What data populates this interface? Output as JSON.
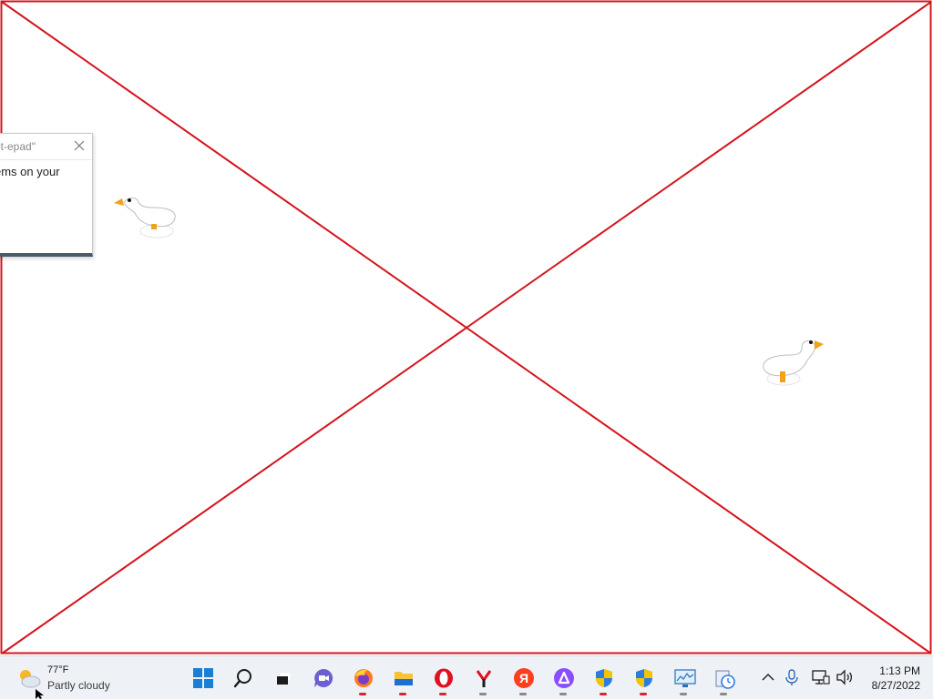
{
  "dialog": {
    "title": "ot-epad\"",
    "message": "ems on your"
  },
  "weather": {
    "temperature": "77°F",
    "condition": "Partly cloudy",
    "icon": "partly-cloudy-icon"
  },
  "taskbar": {
    "apps": [
      {
        "name": "start",
        "icon": "windows-logo-icon",
        "running": false
      },
      {
        "name": "search",
        "icon": "search-icon",
        "running": false
      },
      {
        "name": "task-view",
        "icon": "task-view-icon",
        "running": false
      },
      {
        "name": "chat",
        "icon": "chat-video-icon",
        "running": false
      },
      {
        "name": "firefox",
        "icon": "firefox-icon",
        "running": true
      },
      {
        "name": "file-explorer",
        "icon": "folder-icon",
        "running": true
      },
      {
        "name": "opera",
        "icon": "opera-icon",
        "running": true
      },
      {
        "name": "yandex-browser",
        "icon": "yandex-browser-icon",
        "running": true
      },
      {
        "name": "yandex",
        "icon": "yandex-icon",
        "running": true
      },
      {
        "name": "alice",
        "icon": "alice-icon",
        "running": true
      },
      {
        "name": "defender-1",
        "icon": "shield-icon",
        "running": true
      },
      {
        "name": "defender-2",
        "icon": "shield-icon",
        "running": true
      },
      {
        "name": "resource-monitor",
        "icon": "monitor-chart-icon",
        "running": true
      },
      {
        "name": "utility",
        "icon": "clock-tool-icon",
        "running": true
      }
    ]
  },
  "tray": {
    "clock_time": "1:13 PM",
    "clock_date": "8/27/2022"
  },
  "colors": {
    "frame_line": "#d4141c",
    "taskbar_bg": "#eef1f6",
    "active_indicator": "#d9262c"
  }
}
